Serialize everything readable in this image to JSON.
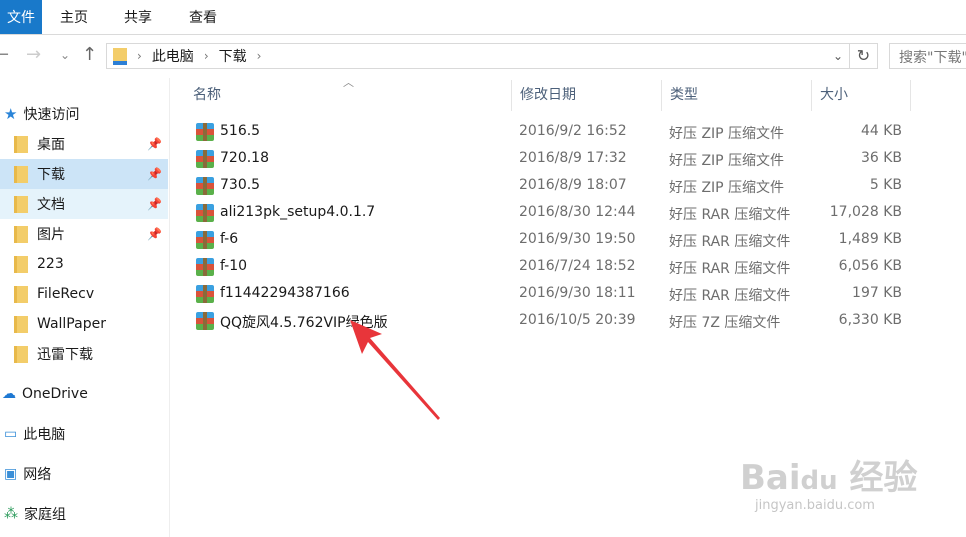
{
  "ribbon": {
    "tabs": [
      "文件",
      "主页",
      "共享",
      "查看"
    ]
  },
  "address": {
    "crumbs": [
      "此电脑",
      "下载"
    ],
    "search_placeholder": "搜索\"下载\""
  },
  "sidebar": {
    "items": [
      {
        "label": "快速访问",
        "icon": "star-icon"
      },
      {
        "label": "桌面",
        "icon": "desktop-folder-icon",
        "pinned": true
      },
      {
        "label": "下载",
        "icon": "download-folder-icon",
        "pinned": true,
        "selected": true
      },
      {
        "label": "文档",
        "icon": "documents-folder-icon",
        "pinned": true
      },
      {
        "label": "图片",
        "icon": "pictures-folder-icon",
        "pinned": true
      },
      {
        "label": "223",
        "icon": "folder-icon"
      },
      {
        "label": "FileRecv",
        "icon": "folder-icon"
      },
      {
        "label": "WallPaper",
        "icon": "folder-icon"
      },
      {
        "label": "迅雷下载",
        "icon": "folder-icon"
      },
      {
        "label": "OneDrive",
        "icon": "cloud-icon"
      },
      {
        "label": "此电脑",
        "icon": "computer-icon"
      },
      {
        "label": "网络",
        "icon": "network-icon"
      },
      {
        "label": "家庭组",
        "icon": "homegroup-icon"
      }
    ]
  },
  "columns": [
    "名称",
    "修改日期",
    "类型",
    "大小"
  ],
  "files": [
    {
      "name": "516.5",
      "date": "2016/9/2 16:52",
      "type": "好压 ZIP 压缩文件",
      "size": "44 KB"
    },
    {
      "name": "720.18",
      "date": "2016/8/9 17:32",
      "type": "好压 ZIP 压缩文件",
      "size": "36 KB"
    },
    {
      "name": "730.5",
      "date": "2016/8/9 18:07",
      "type": "好压 ZIP 压缩文件",
      "size": "5 KB"
    },
    {
      "name": "ali213pk_setup4.0.1.7",
      "date": "2016/8/30 12:44",
      "type": "好压 RAR 压缩文件",
      "size": "17,028 KB"
    },
    {
      "name": "f-6",
      "date": "2016/9/30 19:50",
      "type": "好压 RAR 压缩文件",
      "size": "1,489 KB"
    },
    {
      "name": "f-10",
      "date": "2016/7/24 18:52",
      "type": "好压 RAR 压缩文件",
      "size": "6,056 KB"
    },
    {
      "name": "f11442294387166",
      "date": "2016/9/30 18:11",
      "type": "好压 RAR 压缩文件",
      "size": "197 KB"
    },
    {
      "name": "QQ旋风4.5.762VIP绿色版",
      "date": "2016/10/5 20:39",
      "type": "好压 7Z 压缩文件",
      "size": "6,330 KB"
    }
  ],
  "watermark": {
    "text": "Baidu经验",
    "url": "jingyan.baidu.com"
  },
  "colors": {
    "accent": "#1979ca",
    "selected": "#cce4f7",
    "arrow": "#e8353a"
  }
}
